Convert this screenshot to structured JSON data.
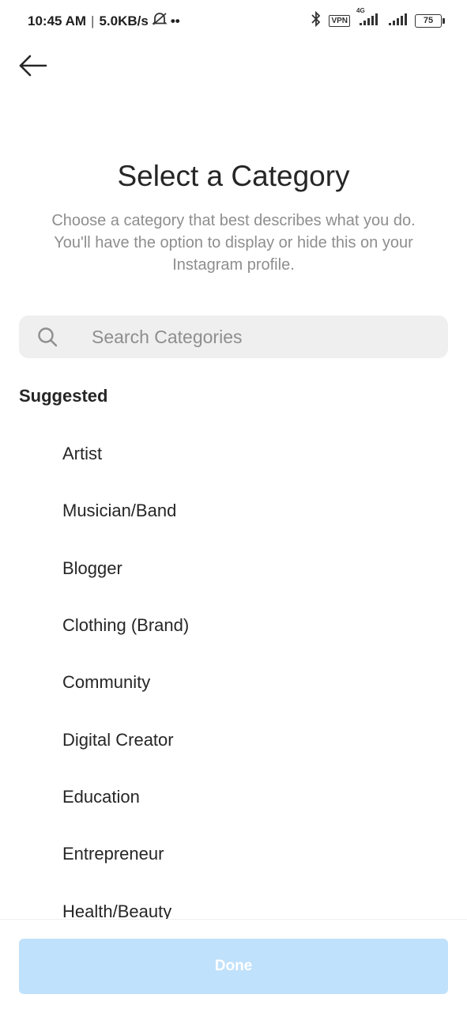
{
  "status_bar": {
    "time": "10:45 AM",
    "separator": "|",
    "speed": "5.0KB/s",
    "more": "••",
    "vpn": "VPN",
    "network": "4G",
    "battery": "75"
  },
  "header": {
    "title": "Select a Category",
    "subtitle": "Choose a category that best describes what you do. You'll have the option to display or hide this on your Instagram profile."
  },
  "search": {
    "placeholder": "Search Categories",
    "value": ""
  },
  "suggested": {
    "label": "Suggested",
    "items": [
      {
        "label": "Artist"
      },
      {
        "label": "Musician/Band"
      },
      {
        "label": "Blogger"
      },
      {
        "label": "Clothing (Brand)"
      },
      {
        "label": "Community"
      },
      {
        "label": "Digital Creator"
      },
      {
        "label": "Education"
      },
      {
        "label": "Entrepreneur"
      },
      {
        "label": "Health/Beauty"
      }
    ]
  },
  "footer": {
    "done_label": "Done"
  },
  "colors": {
    "accent_disabled": "#c0e1fb",
    "text_primary": "#262626",
    "text_secondary": "#8e8e8e",
    "search_bg": "#efefef"
  }
}
